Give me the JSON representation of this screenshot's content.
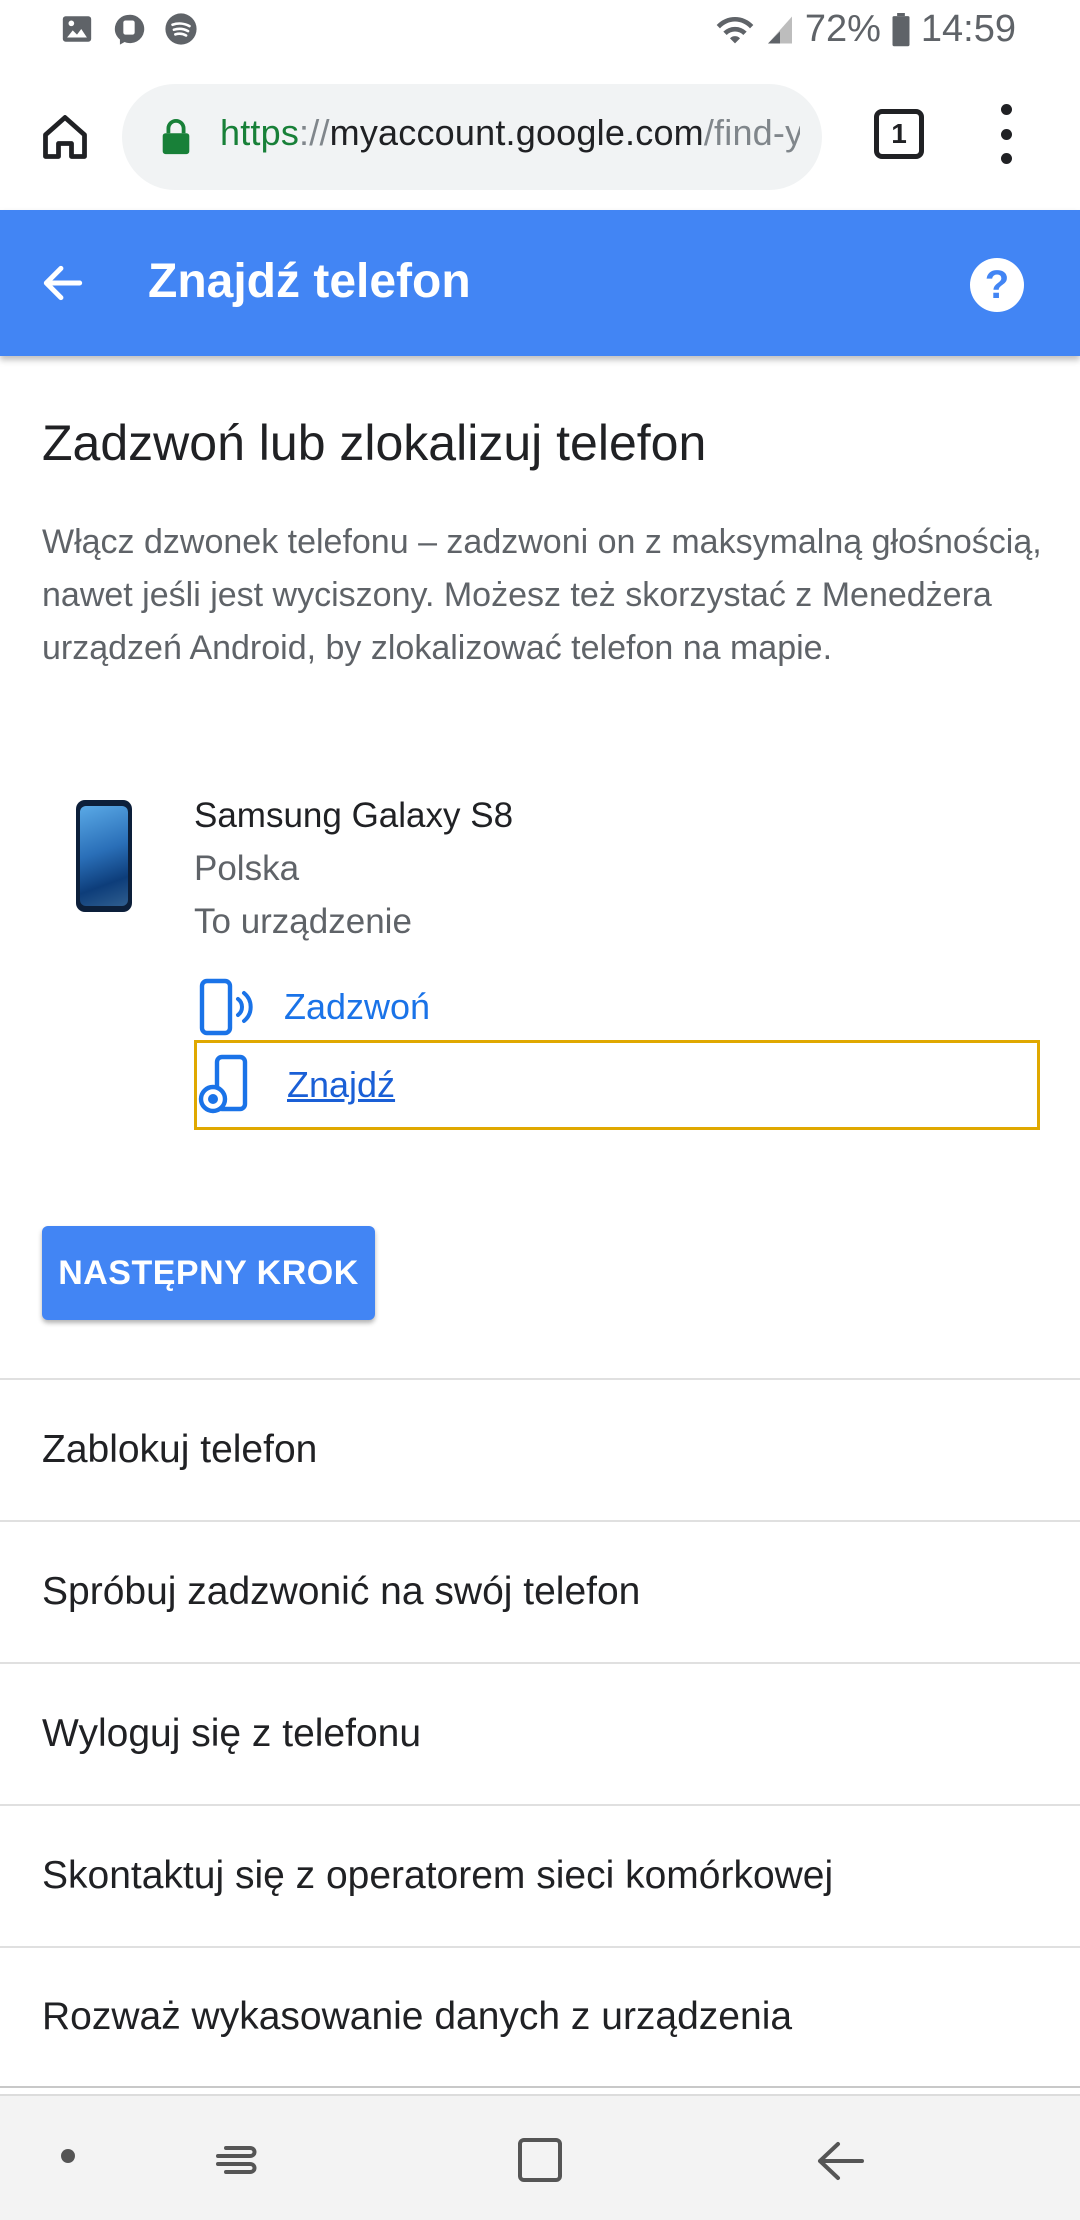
{
  "status_bar": {
    "battery": "72%",
    "time": "14:59",
    "icons": [
      "gallery-icon",
      "messenger-icon",
      "spotify-icon",
      "wifi-icon",
      "signal-icon",
      "battery-icon"
    ]
  },
  "browser": {
    "url_scheme": "https",
    "url_sep": "://",
    "url_host": "myaccount.google.com",
    "url_path": "/find-yo",
    "tab_count": "1"
  },
  "app_bar": {
    "title": "Znajdź telefon",
    "help": "?"
  },
  "content": {
    "heading": "Zadzwoń lub zlokalizuj telefon",
    "description": "Włącz dzwonek telefonu – zadzwoni on z maksymalną głośnością, nawet jeśli jest wyciszony. Możesz też skorzystać z Menedżera urządzeń Android, by zlokalizować telefon na mapie.",
    "device": {
      "name": "Samsung Galaxy S8",
      "country": "Polska",
      "status": "To urządzenie"
    },
    "actions": {
      "call": "Zadzwoń",
      "find": "Znajdź"
    },
    "next_button": "NASTĘPNY KROK"
  },
  "list": [
    "Zablokuj telefon",
    "Spróbuj zadzwonić na swój telefon",
    "Wyloguj się z telefonu",
    "Skontaktuj się z operatorem sieci komórkowej",
    "Rozważ wykasowanie danych z urządzenia"
  ],
  "colors": {
    "accent": "#4285f4",
    "link": "#1a73e8",
    "focus_outline": "#e0a800",
    "secure_green": "#188038"
  }
}
